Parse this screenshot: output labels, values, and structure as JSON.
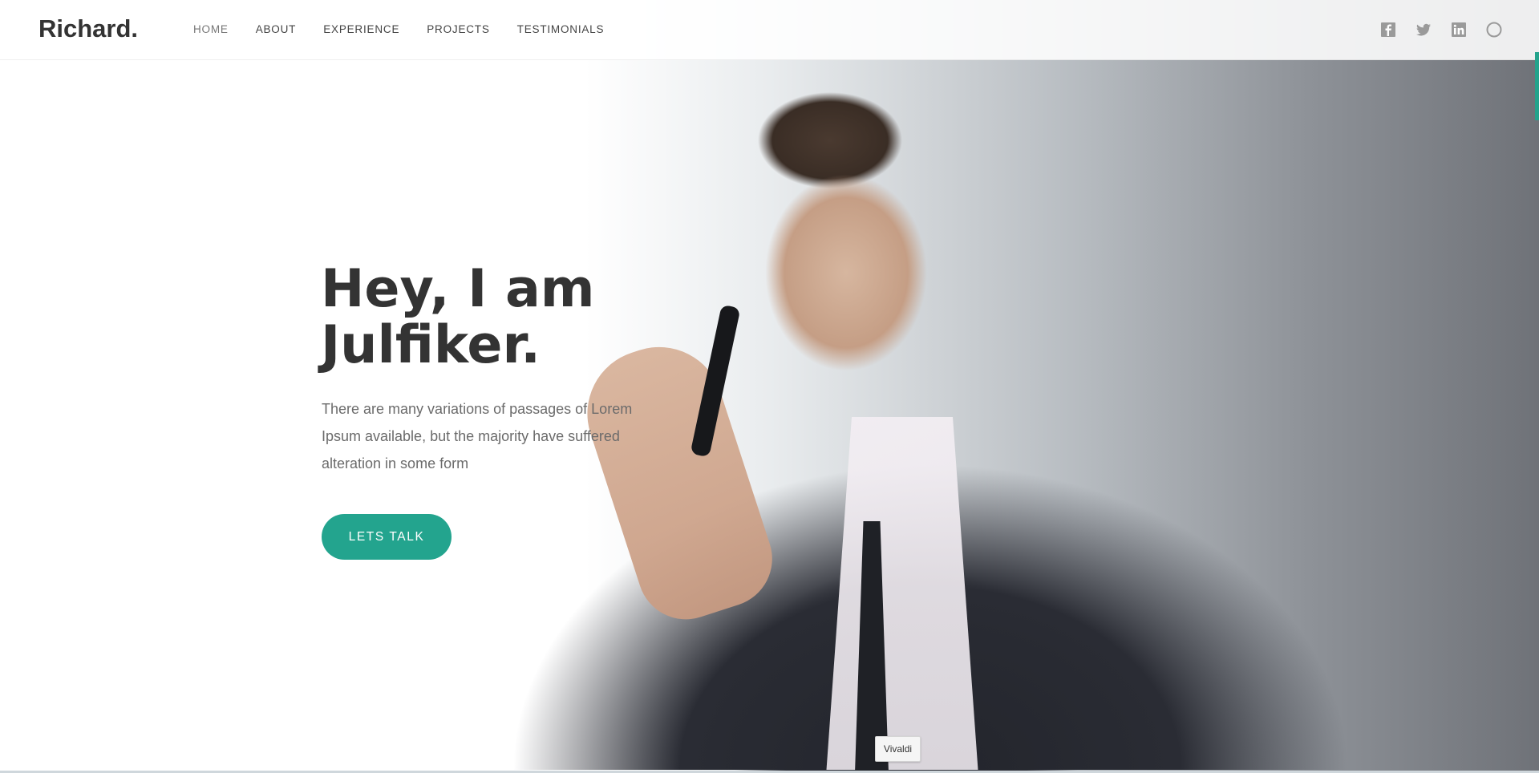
{
  "brand": {
    "logo": "Richard."
  },
  "nav": {
    "items": [
      {
        "label": "HOME",
        "active": true
      },
      {
        "label": "ABOUT",
        "active": false
      },
      {
        "label": "EXPERIENCE",
        "active": false
      },
      {
        "label": "PROJECTS",
        "active": false
      },
      {
        "label": "TESTIMONIALS",
        "active": false
      }
    ]
  },
  "social": {
    "icons": [
      "facebook-icon",
      "twitter-icon",
      "linkedin-icon",
      "circle-icon"
    ]
  },
  "hero": {
    "title_line1": "Hey, I am",
    "title_line2": "Julfiker.",
    "text_line1": "There are many variations of passages of Lorem",
    "text_line2": "Ipsum available, but the majority have suffered",
    "text_line3": "alteration in some form",
    "cta_label": "LETS TALK"
  },
  "tooltip": {
    "label": "Vivaldi"
  },
  "colors": {
    "accent": "#23a48e",
    "heading": "#333333",
    "body_text": "#6b6b6b"
  }
}
